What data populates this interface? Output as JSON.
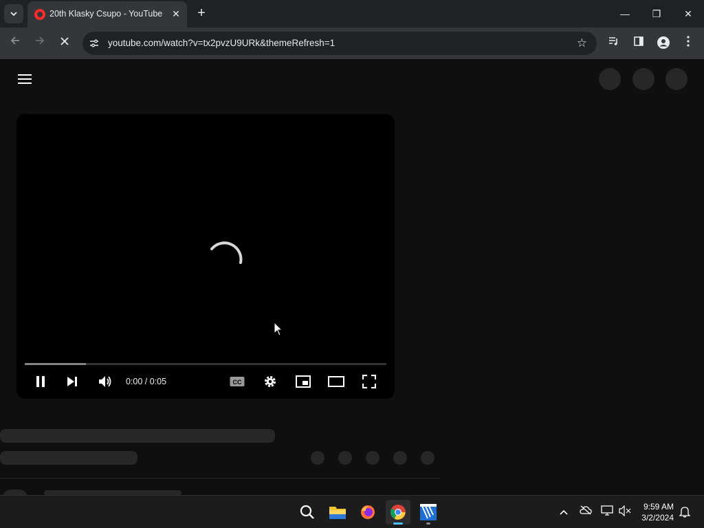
{
  "browser": {
    "tab_title": "20th Klasky Csupo - YouTube",
    "url": "youtube.com/watch?v=tx2pvzU9URk&themeRefresh=1"
  },
  "player": {
    "time_display": "0:00 / 0:05",
    "buffered_fraction": 0.17,
    "icons": [
      "pause-icon",
      "next-icon",
      "volume-icon",
      "cc-icon",
      "settings-icon",
      "miniplayer-icon",
      "theater-icon",
      "fullscreen-icon"
    ]
  },
  "taskbar": {
    "time": "9:59 AM",
    "date": "3/2/2024",
    "apps": [
      "search-icon",
      "file-explorer-icon",
      "firefox-icon",
      "chrome-icon",
      "video-editor-icon"
    ]
  },
  "colors": {
    "page_bg": "#0f0f0f",
    "skeleton": "#272727",
    "youtube_red": "#ff0000",
    "tab_bg": "#35363a",
    "titlebar_bg": "#202124"
  }
}
